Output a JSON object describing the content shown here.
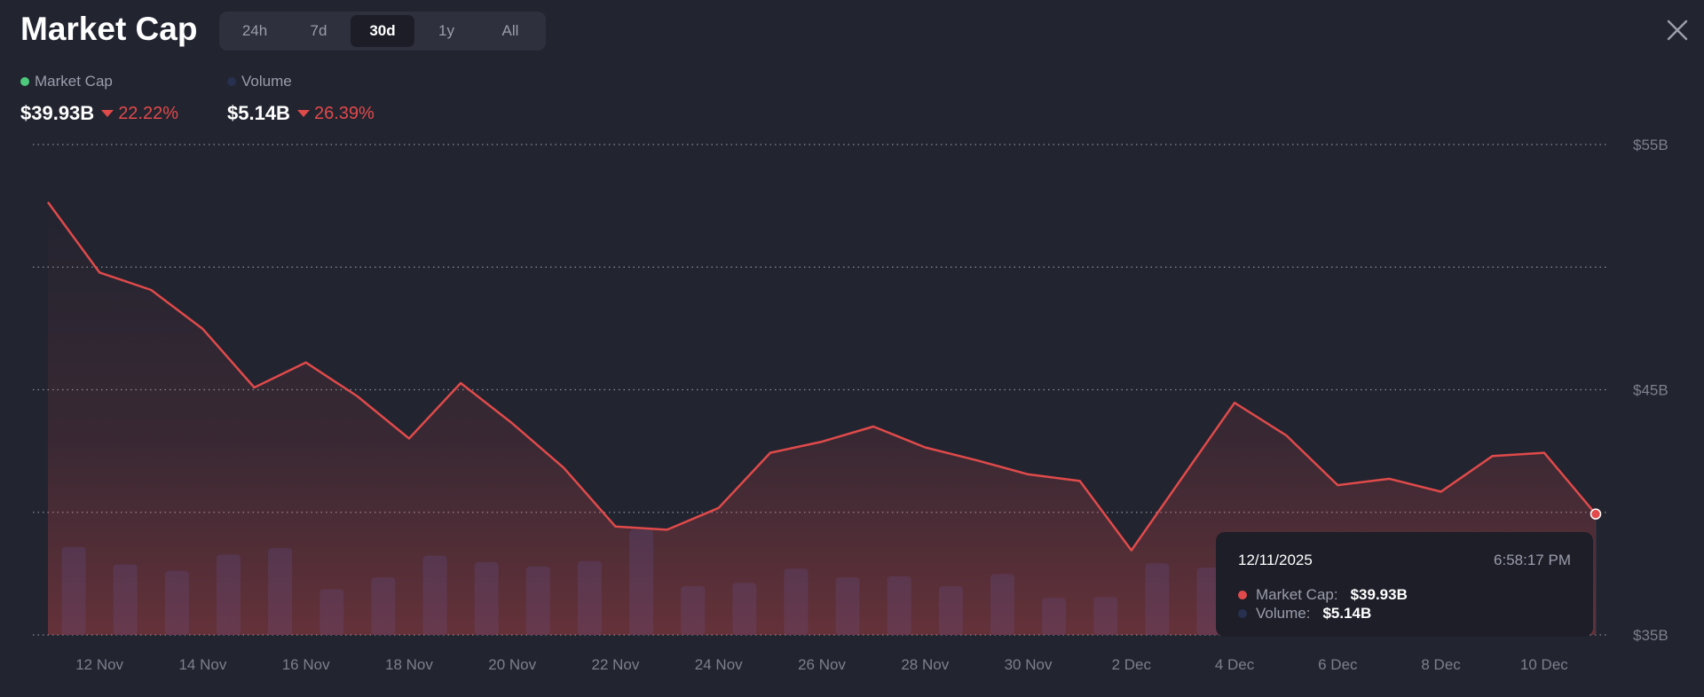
{
  "header": {
    "title": "Market Cap",
    "tabs": [
      {
        "label": "24h",
        "active": false
      },
      {
        "label": "7d",
        "active": false
      },
      {
        "label": "30d",
        "active": true
      },
      {
        "label": "1y",
        "active": false
      },
      {
        "label": "All",
        "active": false
      }
    ],
    "close_icon": "close-x-icon"
  },
  "legend": {
    "market_cap": {
      "label": "Market Cap",
      "value": "$39.93B",
      "change": "22.22%",
      "direction": "down",
      "color": "#4cc97a"
    },
    "volume": {
      "label": "Volume",
      "value": "$5.14B",
      "change": "26.39%",
      "direction": "down",
      "color": "#27304f"
    }
  },
  "tooltip": {
    "date": "12/11/2025",
    "time": "6:58:17 PM",
    "market_cap_label": "Market Cap:",
    "market_cap_value": "$39.93B",
    "volume_label": "Volume:",
    "volume_value": "$5.14B",
    "market_cap_color": "#e04a4a",
    "volume_color": "#27304f"
  },
  "chart_data": {
    "type": "line",
    "x": [
      "11 Nov",
      "12 Nov",
      "13 Nov",
      "14 Nov",
      "15 Nov",
      "16 Nov",
      "17 Nov",
      "18 Nov",
      "19 Nov",
      "20 Nov",
      "21 Nov",
      "22 Nov",
      "23 Nov",
      "24 Nov",
      "25 Nov",
      "26 Nov",
      "27 Nov",
      "28 Nov",
      "29 Nov",
      "30 Nov",
      "1 Dec",
      "2 Dec",
      "3 Dec",
      "4 Dec",
      "5 Dec",
      "6 Dec",
      "7 Dec",
      "8 Dec",
      "9 Dec",
      "10 Dec",
      "11 Dec"
    ],
    "x_tick_labels": [
      "12 Nov",
      "14 Nov",
      "16 Nov",
      "18 Nov",
      "20 Nov",
      "22 Nov",
      "24 Nov",
      "26 Nov",
      "28 Nov",
      "30 Nov",
      "2 Dec",
      "4 Dec",
      "6 Dec",
      "8 Dec",
      "10 Dec"
    ],
    "y_tick_labels": [
      "$55B",
      "$45B",
      "$35B"
    ],
    "ylim": [
      35,
      55
    ],
    "grid_values": [
      55,
      50,
      45,
      40,
      35
    ],
    "grid": true,
    "series": [
      {
        "name": "Market Cap",
        "color": "#e04a4a",
        "values": [
          52.65,
          49.78,
          49.07,
          47.48,
          45.09,
          46.11,
          44.73,
          43.01,
          45.27,
          43.63,
          41.81,
          39.42,
          39.29,
          40.18,
          42.43,
          42.88,
          43.5,
          42.65,
          42.12,
          41.55,
          41.28,
          38.45,
          41.46,
          44.47,
          43.14,
          41.11,
          41.37,
          40.84,
          42.3,
          42.43,
          39.93
        ]
      },
      {
        "name": "Volume",
        "color": "#27304f",
        "type": "bar",
        "values": [
          8.1,
          6.5,
          5.9,
          7.4,
          8.0,
          4.2,
          5.3,
          7.3,
          6.7,
          6.3,
          6.8,
          9.7,
          4.5,
          4.8,
          6.1,
          5.3,
          5.4,
          4.5,
          5.6,
          3.4,
          3.5,
          6.6,
          6.2,
          6.0
        ]
      }
    ]
  }
}
